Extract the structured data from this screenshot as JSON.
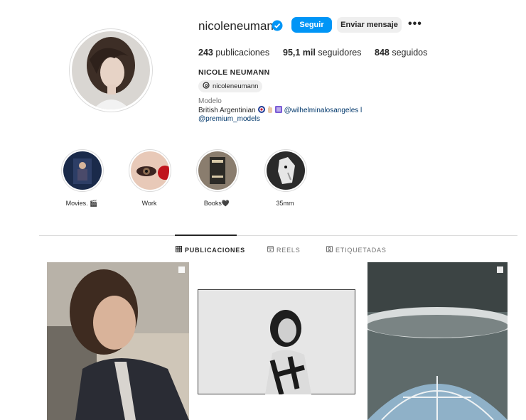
{
  "profile": {
    "username": "nicoleneumann",
    "verified_icon": "verified-badge-icon",
    "follow_label": "Seguir",
    "message_label": "Enviar mensaje",
    "more_label": "•••",
    "posts_count": "243",
    "posts_label": "publicaciones",
    "followers_count": "95,1 mil",
    "followers_label": "seguidores",
    "following_count": "848",
    "following_label": "seguidos",
    "full_name": "NICOLE NEUMANN",
    "threads_handle": "nicoleneumann",
    "category": "Modelo",
    "bio_text": "British Argentinian",
    "bio_link1": "@wilhelminalosangeles l",
    "bio_link2": "@premium_models"
  },
  "highlights": [
    {
      "label": "Movies. 🎬"
    },
    {
      "label": "Work"
    },
    {
      "label": "Books🖤"
    },
    {
      "label": "35mm"
    }
  ],
  "tabs": [
    {
      "label": "PUBLICACIONES",
      "active": true
    },
    {
      "label": "REELS",
      "active": false
    },
    {
      "label": "ETIQUETADAS",
      "active": false
    }
  ],
  "colors": {
    "accent": "#0095f6",
    "link": "#00376b"
  }
}
